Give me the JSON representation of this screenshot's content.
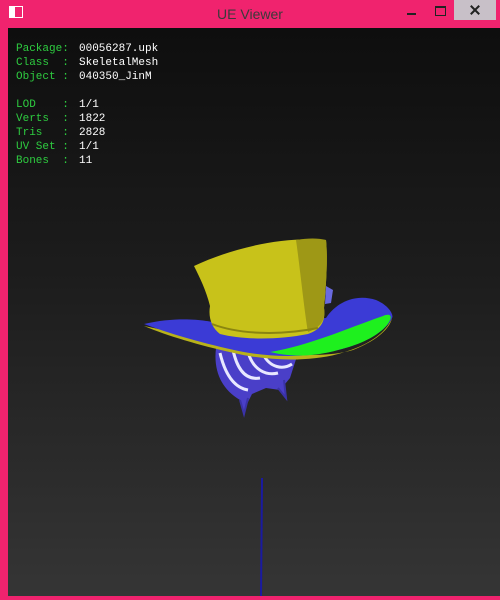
{
  "window": {
    "title": "UE Viewer",
    "icon": "app-icon",
    "controls": [
      "minimize-icon",
      "maximize-icon",
      "close-icon"
    ],
    "accent_color": "#f0236e"
  },
  "info": {
    "package_label": "Package:",
    "package_value": "00056287.upk",
    "class_label": "Class  :",
    "class_value": "SkeletalMesh",
    "object_label": "Object :",
    "object_value": "040350_JinM",
    "lod_label": "LOD    :",
    "lod_value": "1/1",
    "verts_label": "Verts  :",
    "verts_value": "1822",
    "tris_label": "Tris   :",
    "tris_value": "2828",
    "uvset_label": "UV Set :",
    "uvset_value": "1/1",
    "bones_label": "Bones  :",
    "bones_value": "11"
  },
  "colors": {
    "label": "#2ecc40",
    "value": "#ffffff",
    "hat": "#c8c21a",
    "brim_top": "#3b3bd6",
    "brim_highlight": "#1ef01e",
    "hair": "#4a3fc8"
  }
}
